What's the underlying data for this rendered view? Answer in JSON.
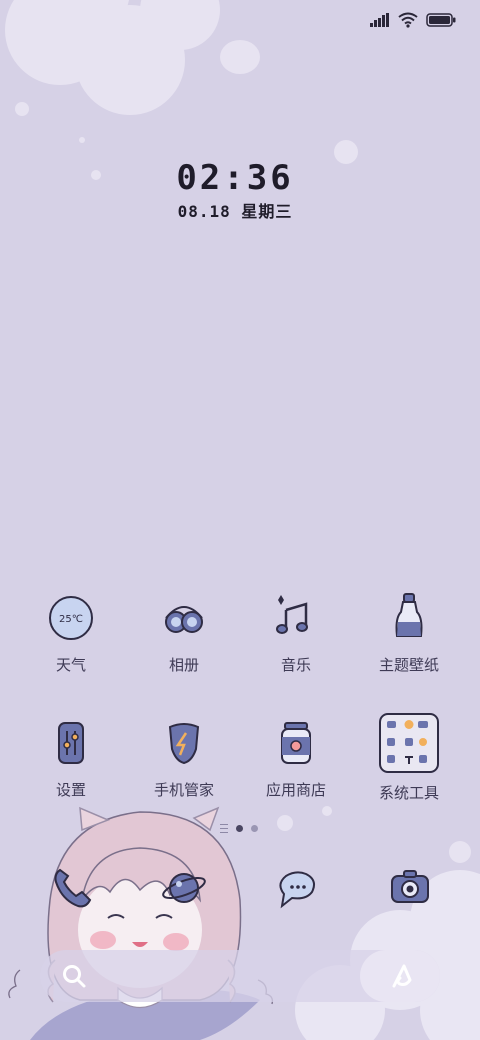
{
  "lockscreen": {
    "time": "02:36",
    "date": "08.18 星期三"
  },
  "weather_badge": "25℃",
  "apps": [
    {
      "label": "天气",
      "icon": "weather-icon"
    },
    {
      "label": "相册",
      "icon": "gallery-icon"
    },
    {
      "label": "音乐",
      "icon": "music-icon"
    },
    {
      "label": "主题壁纸",
      "icon": "themes-icon"
    },
    {
      "label": "设置",
      "icon": "settings-icon"
    },
    {
      "label": "手机管家",
      "icon": "security-icon"
    },
    {
      "label": "应用商店",
      "icon": "app-store-icon"
    },
    {
      "label": "系统工具",
      "icon": "system-tools-folder-icon"
    }
  ],
  "dock": [
    {
      "icon": "phone-icon"
    },
    {
      "icon": "browser-icon"
    },
    {
      "icon": "messages-icon"
    },
    {
      "icon": "camera-icon"
    }
  ],
  "page_indicator": {
    "pages": 2,
    "current": 1
  },
  "colors": {
    "background": "#d6d1e6",
    "icon_blue": "#6b74ad",
    "text": "#3e3a55"
  }
}
